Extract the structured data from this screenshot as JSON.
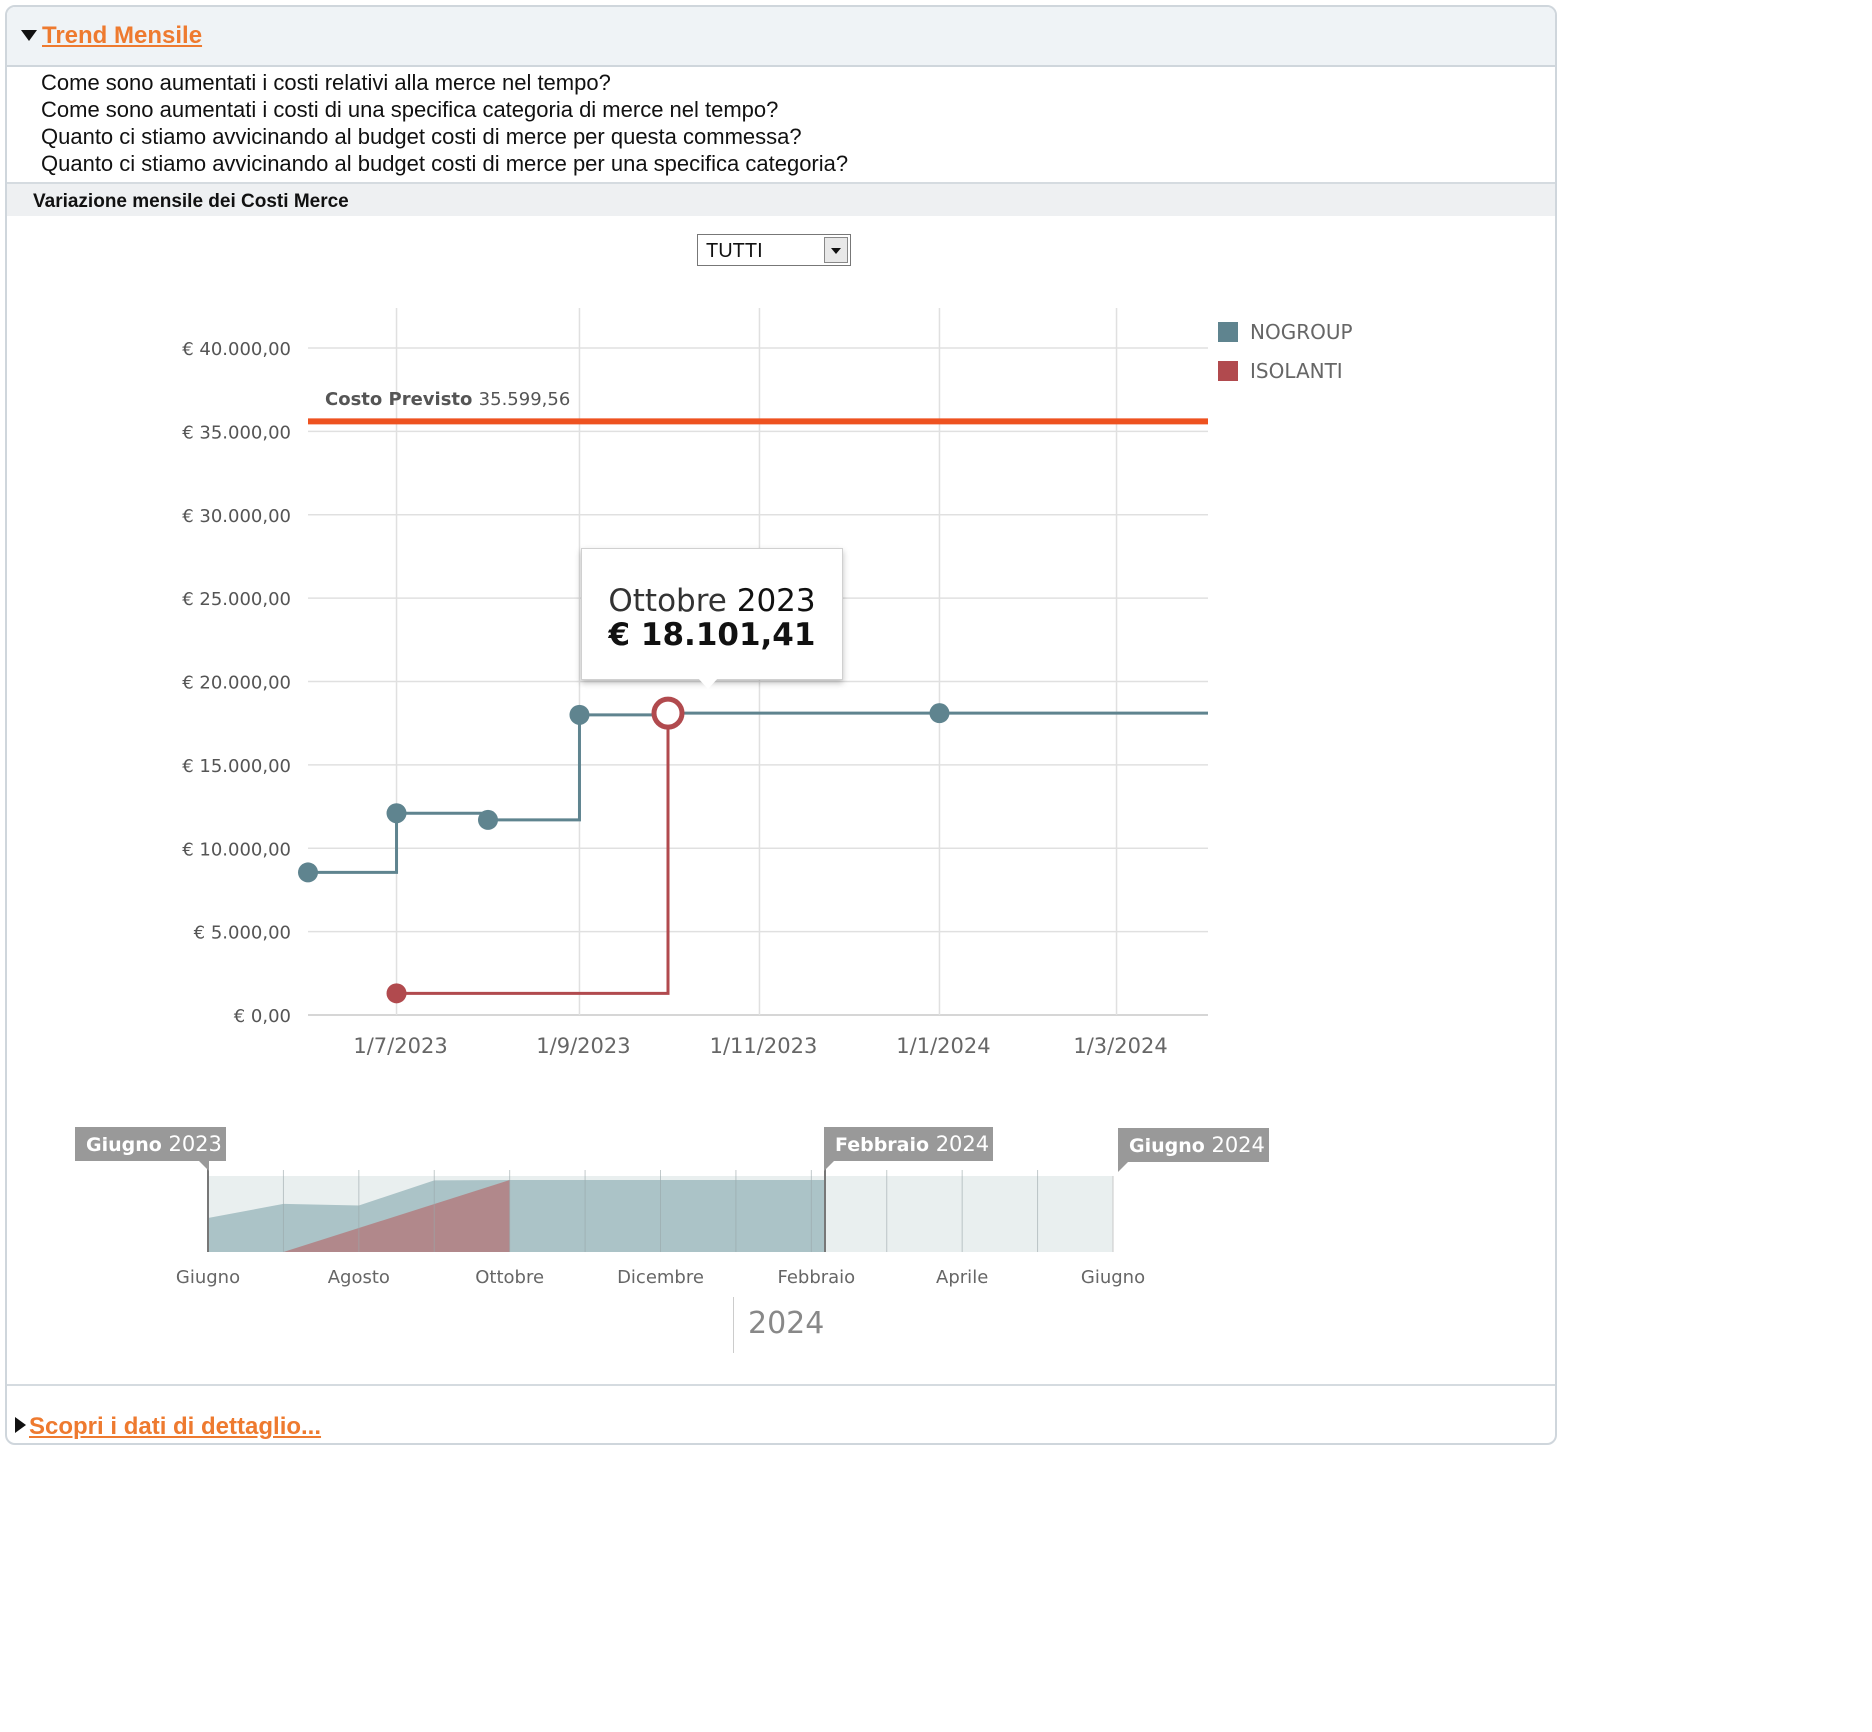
{
  "section": {
    "title": "Trend Mensile",
    "questions": [
      "Come sono aumentati i costi relativi alla merce nel tempo?",
      "Come sono aumentati i costi di una specifica categoria di merce nel tempo?",
      "Quanto ci stiamo avvicinando al budget costi di merce per questa commessa?",
      "Quanto ci stiamo avvicinando al budget costi di merce per una specifica categoria?"
    ],
    "subheader": "Variazione mensile dei Costi Merce",
    "filter_value": "TUTTI",
    "footer_link": "Scopri i dati di dettaglio..."
  },
  "colors": {
    "accent_link": "#ee7a2f",
    "nogroup": "#5f848f",
    "isolanti": "#b14a4e",
    "budget_line": "#ee5220"
  },
  "chart_data": {
    "type": "line",
    "step": true,
    "ylim": [
      0,
      40000
    ],
    "y_ticks": [
      0,
      5000,
      10000,
      15000,
      20000,
      25000,
      30000,
      35000,
      40000
    ],
    "y_tick_labels": [
      "€ 0,00",
      "€ 5.000,00",
      "€ 10.000,00",
      "€ 15.000,00",
      "€ 20.000,00",
      "€ 25.000,00",
      "€ 30.000,00",
      "€ 35.000,00",
      "€ 40.000,00"
    ],
    "x_ticks": [
      "2023-07-01",
      "2023-09-01",
      "2023-11-01",
      "2024-01-01",
      "2024-03-01"
    ],
    "x_tick_labels": [
      "1/7/2023",
      "1/9/2023",
      "1/11/2023",
      "1/1/2024",
      "1/3/2024"
    ],
    "xlim": [
      "2023-06-01",
      "2024-04-01"
    ],
    "grid": true,
    "legend_position": "top-right",
    "series": [
      {
        "name": "NOGROUP",
        "color": "#5f848f",
        "points": [
          {
            "x": "2023-06-01",
            "y": 8550
          },
          {
            "x": "2023-07-01",
            "y": 12100
          },
          {
            "x": "2023-08-01",
            "y": 11700
          },
          {
            "x": "2023-09-01",
            "y": 18000
          },
          {
            "x": "2023-10-01",
            "y": 18101.41
          },
          {
            "x": "2024-01-01",
            "y": 18101.41
          }
        ]
      },
      {
        "name": "ISOLANTI",
        "color": "#b14a4e",
        "points": [
          {
            "x": "2023-07-01",
            "y": 1300
          },
          {
            "x": "2023-10-01",
            "y": 18101.41
          }
        ]
      }
    ],
    "reference_line": {
      "label": "Costo Previsto",
      "value_label": "35.599,56",
      "value": 35599.56,
      "color": "#ee5220"
    },
    "tooltip": {
      "month": "Ottobre",
      "year": "2023",
      "value": "€ 18.101,41"
    },
    "navigator": {
      "month_labels": [
        "Giugno",
        "Agosto",
        "Ottobre",
        "Dicembre",
        "Febbraio",
        "Aprile",
        "Giugno"
      ],
      "year_label": "2024",
      "flags": [
        {
          "month": "Giugno",
          "year": "2023"
        },
        {
          "month": "Febbraio",
          "year": "2024"
        },
        {
          "month": "Giugno",
          "year": "2024"
        }
      ]
    }
  }
}
